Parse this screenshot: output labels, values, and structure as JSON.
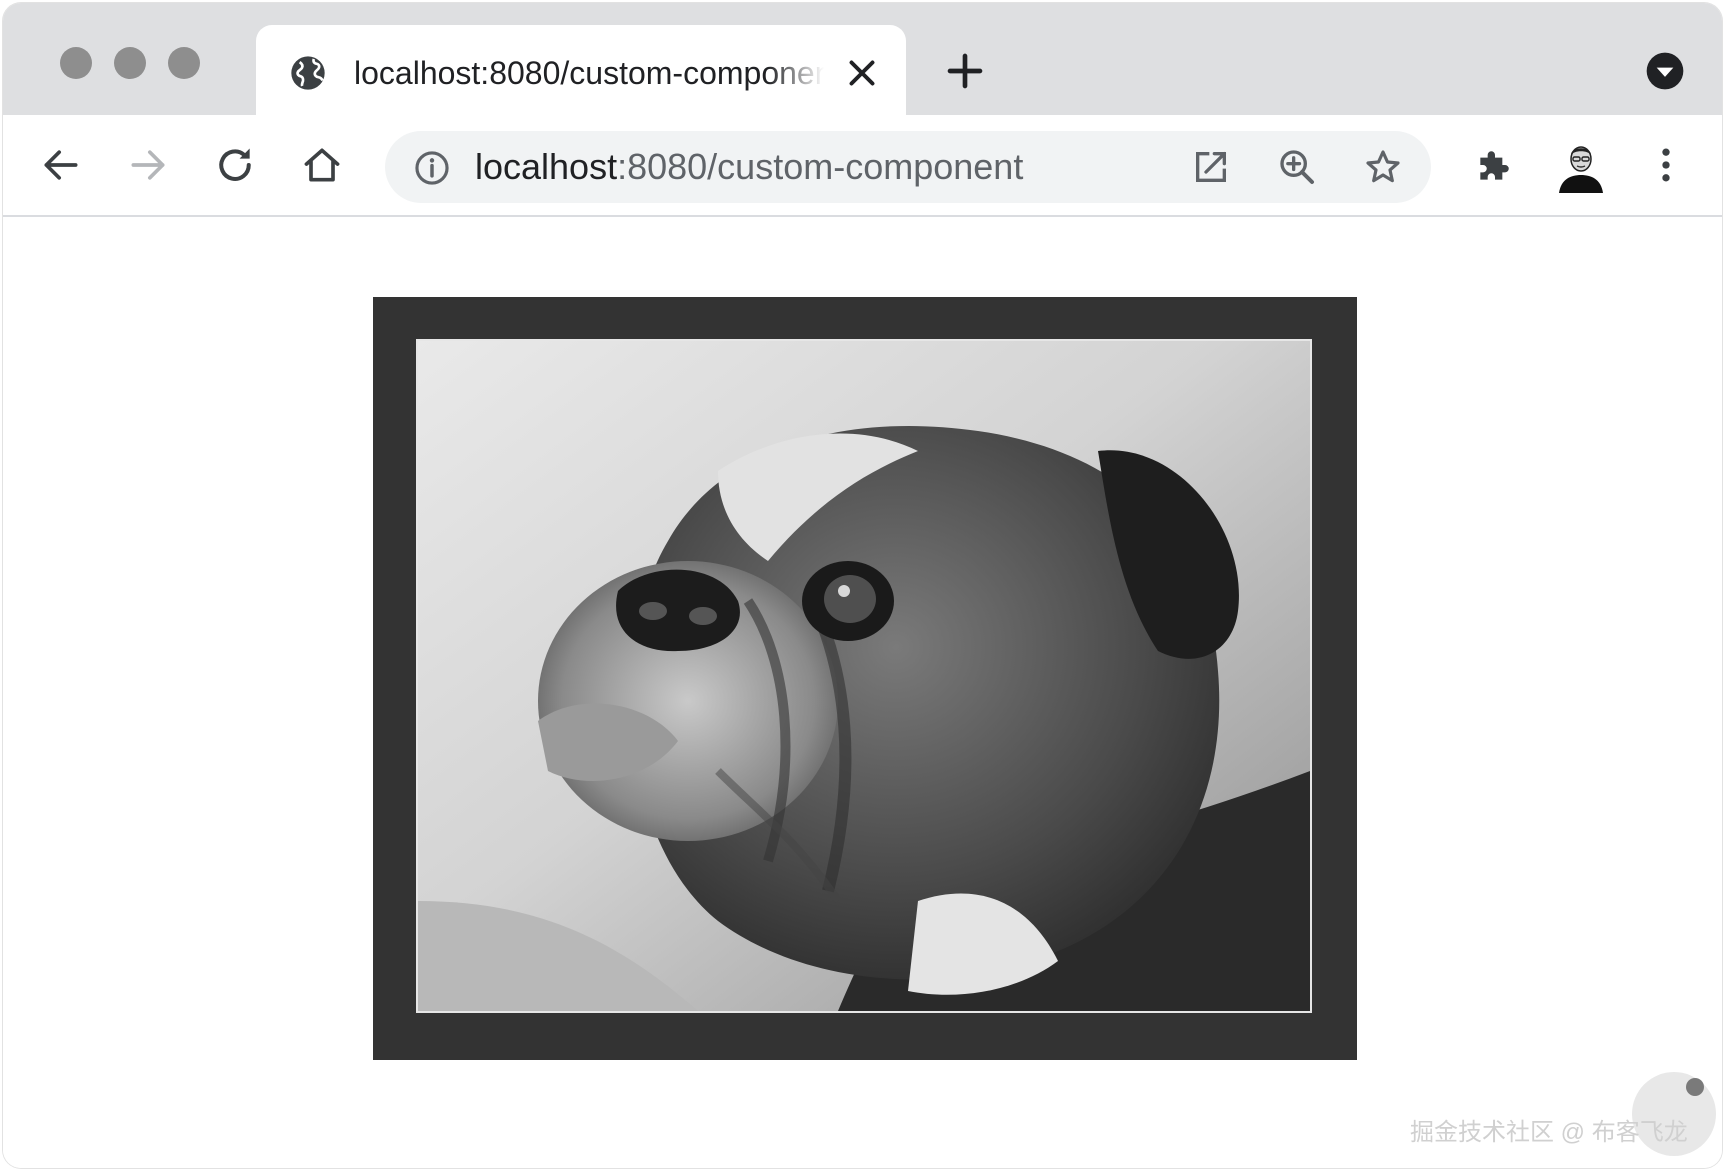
{
  "browser": {
    "tab": {
      "title": "localhost:8080/custom-component",
      "favicon": "globe-icon",
      "close_icon": "close-icon"
    },
    "new_tab_icon": "plus-icon",
    "tab_menu_icon": "chevron-down-circle-icon",
    "nav": {
      "back_icon": "back-arrow-icon",
      "forward_icon": "forward-arrow-icon",
      "reload_icon": "reload-icon",
      "home_icon": "home-icon"
    },
    "address_bar": {
      "host": "localhost",
      "rest": ":8080/custom-component",
      "info_icon": "info-icon",
      "actions": [
        "open-in-new-icon",
        "zoom-in-icon",
        "star-icon"
      ]
    },
    "toolbar_right": [
      "extensions-icon",
      "avatar",
      "more-vert-icon"
    ]
  },
  "page": {
    "image": {
      "subject": "black-and-white photo of a bulldog",
      "frame_color": "#333333",
      "border_color": "#e6e6e6"
    }
  },
  "watermark": {
    "text": "掘金技术社区 @ 布客飞龙"
  },
  "colors": {
    "tab_strip": "#dedfe1",
    "traffic_lights": "#8e8e8e",
    "omnibox": "#f1f3f4",
    "icon": "#5f6368",
    "text": "#202124"
  }
}
